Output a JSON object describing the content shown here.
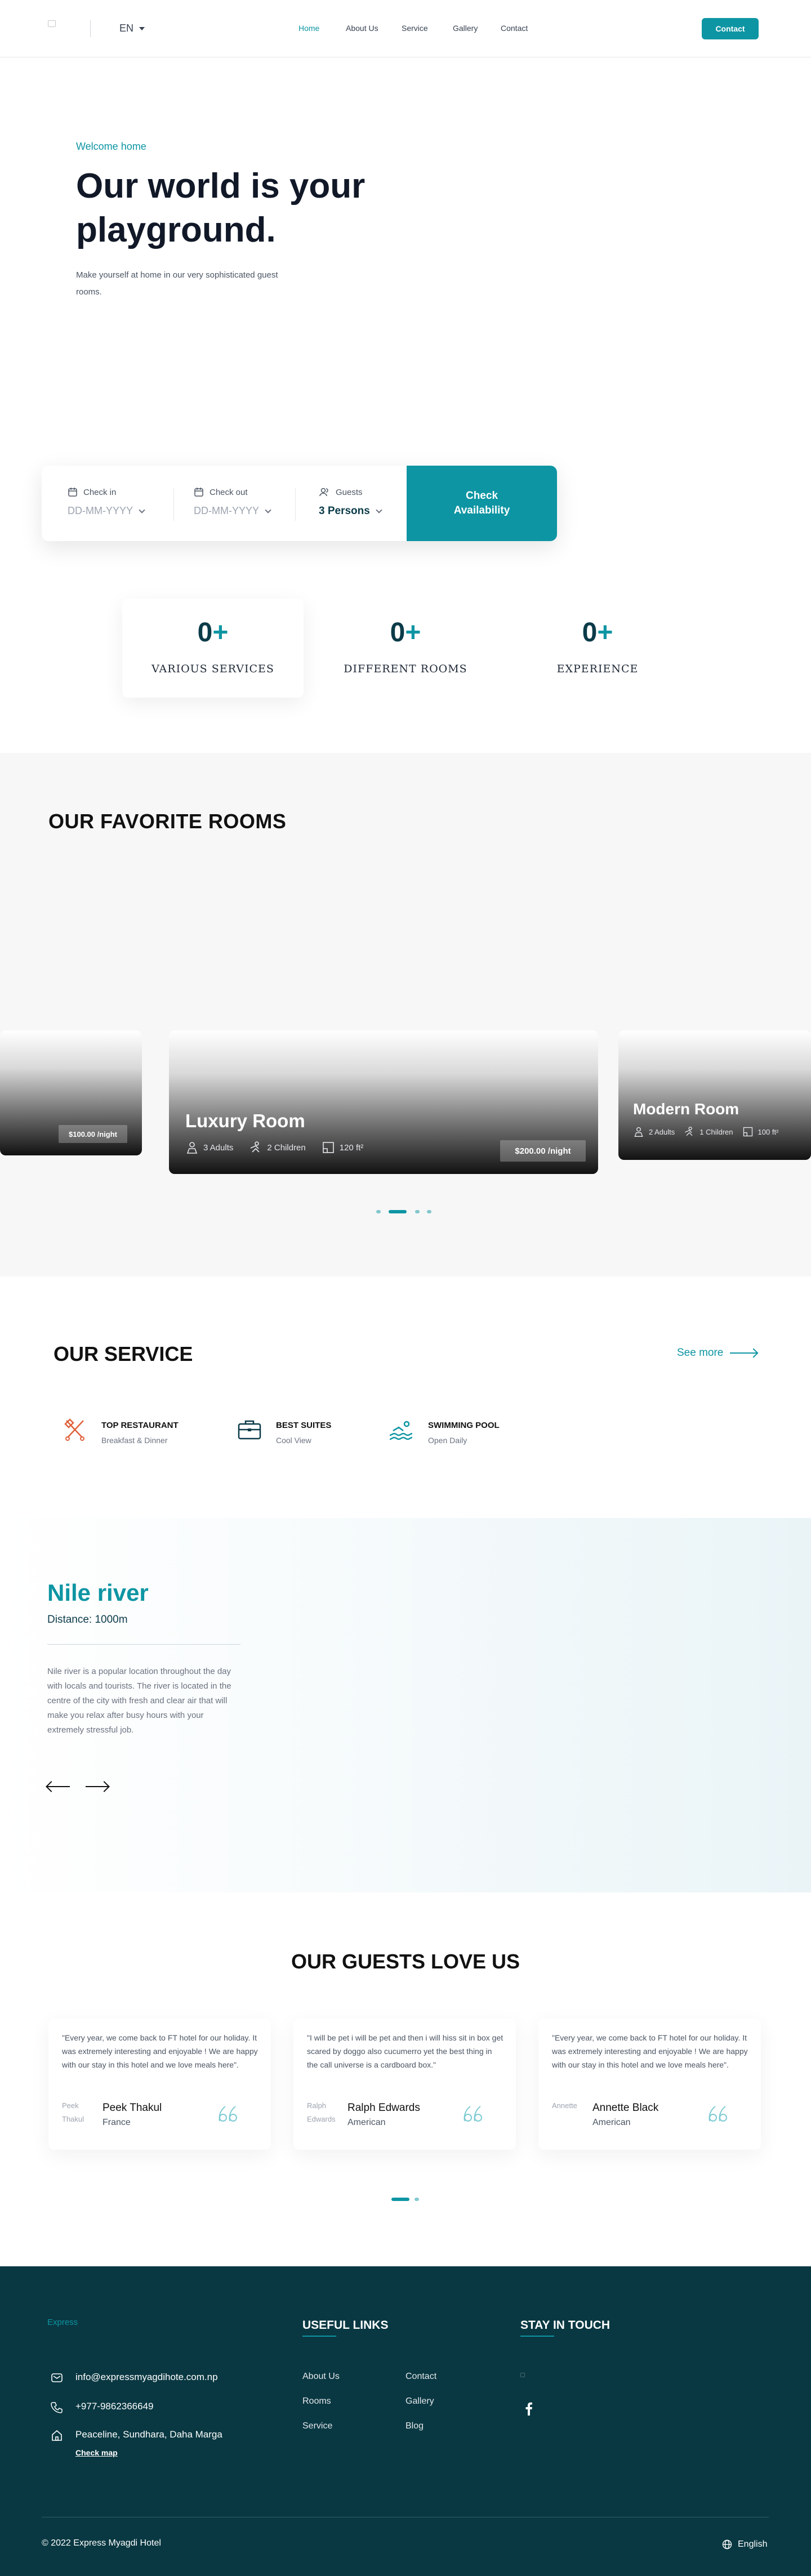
{
  "header": {
    "logo_alt": "",
    "language": "EN",
    "nav": [
      "Home",
      "About Us",
      "Service",
      "Gallery",
      "Contact"
    ],
    "contact_label": "Contact",
    "active_color": "#0e95a3"
  },
  "hero": {
    "kicker": "Welcome home",
    "title": "Our world is your playground.",
    "subtitle": "Make yourself at home in our very sophisticated guest rooms."
  },
  "booking": {
    "check_in_label": "Check in",
    "check_in_value": "DD-MM-YYYY",
    "check_out_label": "Check out",
    "check_out_value": "DD-MM-YYYY",
    "guests_label": "Guests",
    "guests_value": "3 Persons",
    "button_label": "Check Availability"
  },
  "stats": [
    {
      "number": "0",
      "suffix": "+",
      "label": "VARIOUS SERVICES"
    },
    {
      "number": "0",
      "suffix": "+",
      "label": "DIFFERENT ROOMS"
    },
    {
      "number": "0",
      "suffix": "+",
      "label": "EXPERIENCE"
    }
  ],
  "rooms": {
    "title": "OUR FAVORITE ROOMS",
    "items": [
      {
        "name": "",
        "price": "$100.00 /night"
      },
      {
        "name": "Luxury Room",
        "adults": "3 Adults",
        "children": "2 Children",
        "area": "120 ft²",
        "price": "$200.00 /night"
      },
      {
        "name": "Modern Room",
        "adults": "2 Adults",
        "children": "1 Children",
        "area": "100 ft²"
      }
    ]
  },
  "services": {
    "title": "OUR SERVICE",
    "see_more": "See more",
    "items": [
      {
        "title": "TOP RESTAURANT",
        "subtitle": "Breakfast & Dinner",
        "icon": "utensils-icon",
        "color": "#e0623c"
      },
      {
        "title": "BEST SUITES",
        "subtitle": "Cool View",
        "icon": "briefcase-icon",
        "color": "#0b3b49"
      },
      {
        "title": "SWIMMING POOL",
        "subtitle": "Open Daily",
        "icon": "swimming-icon",
        "color": "#0e95a3"
      }
    ]
  },
  "nile": {
    "title": "Nile river",
    "distance": "Distance: 1000m",
    "description": "Nile river is a popular location throughout the day with locals and tourists. The river is located in the centre of the city with fresh and clear air that will make you relax after busy hours with your extremely stressful job."
  },
  "guests": {
    "title": "OUR GUESTS LOVE US",
    "reviews": [
      {
        "text": "\"Every year, we come back to FT hotel for our holiday. It was extremely interesting and enjoyable ! We are happy with our stay in this hotel and we love meals here\".",
        "avatar_alt": "Peek Thakul",
        "name": "Peek Thakul",
        "country": "France"
      },
      {
        "text": "\"I will be pet i will be pet and then i will hiss sit in box get scared by doggo also cucumerro yet the best thing in the call universe is a cardboard box.\"",
        "avatar_alt": "Ralph Edwards",
        "name": "Ralph Edwards",
        "country": "American"
      },
      {
        "text": "\"Every year, we come back to FT hotel for our holiday. It was extremely interesting and enjoyable ! We are happy with our stay in this hotel and we love meals here\".",
        "avatar_alt": "Annette",
        "name": "Annette Black",
        "country": "American"
      }
    ]
  },
  "footer": {
    "logo_alt": "Express",
    "email": "info@expressmyagdihote.com.np",
    "phone": "+977-9862366649",
    "address": "Peaceline, Sundhara, Daha Marga",
    "map_link": "Check map",
    "useful_links_title": "USEFUL LINKS",
    "links_col1": [
      "About Us",
      "Rooms",
      "Service"
    ],
    "links_col2": [
      "Contact",
      "Gallery",
      "Blog"
    ],
    "stay_title": "STAY IN TOUCH",
    "copyright": "© 2022 Express Myagdi Hotel",
    "language": "English"
  }
}
